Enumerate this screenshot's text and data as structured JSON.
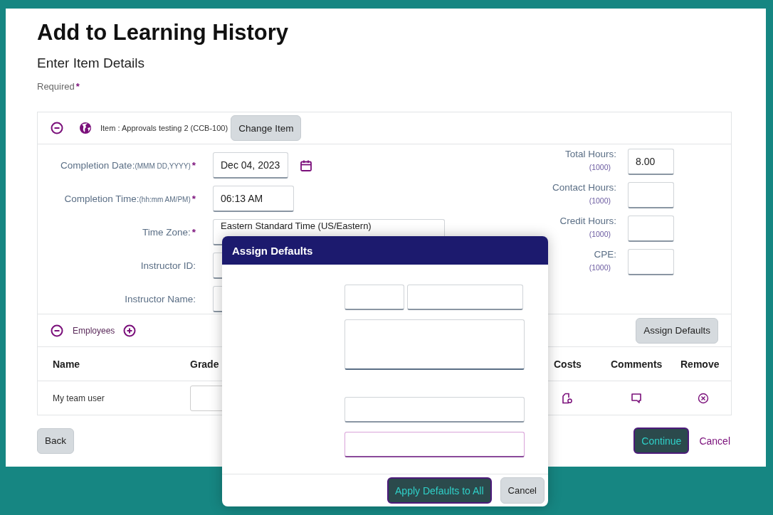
{
  "page": {
    "title": "Add to Learning History",
    "subtitle": "Enter Item Details",
    "required_label": "Required",
    "required_mark": "*"
  },
  "item": {
    "expanded": true,
    "label": "Item : Approvals testing 2 (CCB-100)",
    "change_button": "Change Item"
  },
  "fields": [
    {
      "kind": "date",
      "label": "Completion Date:",
      "hint": "(MMM DD,YYYY)",
      "mark": "*",
      "value": "Dec 04, 2023"
    },
    {
      "kind": "text",
      "label": "Completion Time:",
      "hint": "(hh:mm AM/PM)",
      "mark": "*",
      "value": "06:13 AM"
    },
    {
      "kind": "select",
      "label": "Time Zone:",
      "mark": "*",
      "value": "Eastern Standard Time (US/Eastern)"
    },
    {
      "kind": "text",
      "label": "Instructor ID:"
    },
    {
      "kind": "text",
      "label": "Instructor Name:"
    }
  ],
  "hours": [
    {
      "label": "Total Hours:",
      "hint": "(1000)",
      "value": "8.00"
    },
    {
      "label": "Contact Hours:",
      "hint": "(1000)"
    },
    {
      "label": "Credit Hours:",
      "hint": "(1000)"
    },
    {
      "label": "CPE:",
      "hint": "(1000)"
    }
  ],
  "employees": {
    "expanded": true,
    "label": "Employees",
    "assign_button": "Assign Defaults",
    "columns": [
      "Name",
      "Grade",
      "Costs",
      "Comments",
      "Remove"
    ],
    "rows": [
      {
        "name": "My team user"
      }
    ]
  },
  "buttons": {
    "back": "Back",
    "continue": "Continue",
    "cancel": "Cancel"
  },
  "modal": {
    "title": "Assign Defaults",
    "fields": [
      {
        "kind": "pair",
        "focused": false
      },
      {
        "kind": "textarea",
        "focused": false
      },
      {
        "kind": "input",
        "focused": false
      },
      {
        "kind": "input",
        "focused": true
      }
    ],
    "apply_button": "Apply Defaults to All",
    "cancel_button": "Cancel"
  }
}
